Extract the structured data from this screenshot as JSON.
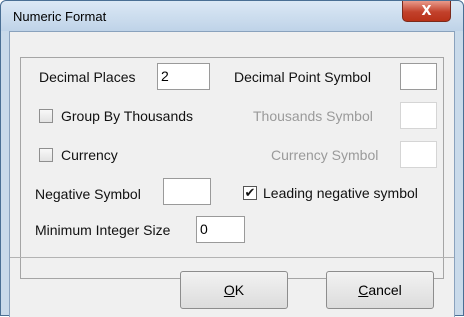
{
  "window": {
    "title": "Numeric Format",
    "close_glyph": "X"
  },
  "form": {
    "decimal_places": {
      "label": "Decimal Places",
      "value": "2"
    },
    "decimal_point_symbol": {
      "label": "Decimal Point Symbol",
      "value": ""
    },
    "group_by_thousands": {
      "label": "Group By Thousands",
      "checked": false
    },
    "thousands_symbol": {
      "label": "Thousands Symbol",
      "value": "",
      "enabled": false
    },
    "currency": {
      "label": "Currency",
      "checked": false
    },
    "currency_symbol": {
      "label": "Currency Symbol",
      "value": "",
      "enabled": false
    },
    "negative_symbol": {
      "label": "Negative Symbol",
      "value": ""
    },
    "leading_negative_symbol": {
      "label": "Leading negative symbol",
      "checked": true,
      "check_glyph": "✔"
    },
    "minimum_integer_size": {
      "label": "Minimum Integer Size",
      "value": "0"
    }
  },
  "buttons": {
    "ok": {
      "mnemonic": "O",
      "rest": "K"
    },
    "cancel": {
      "mnemonic": "C",
      "rest": "ancel"
    }
  },
  "colors": {
    "titlebar": "#c9daea",
    "close_button": "#c2412b",
    "client_background": "#f0f0f0"
  }
}
